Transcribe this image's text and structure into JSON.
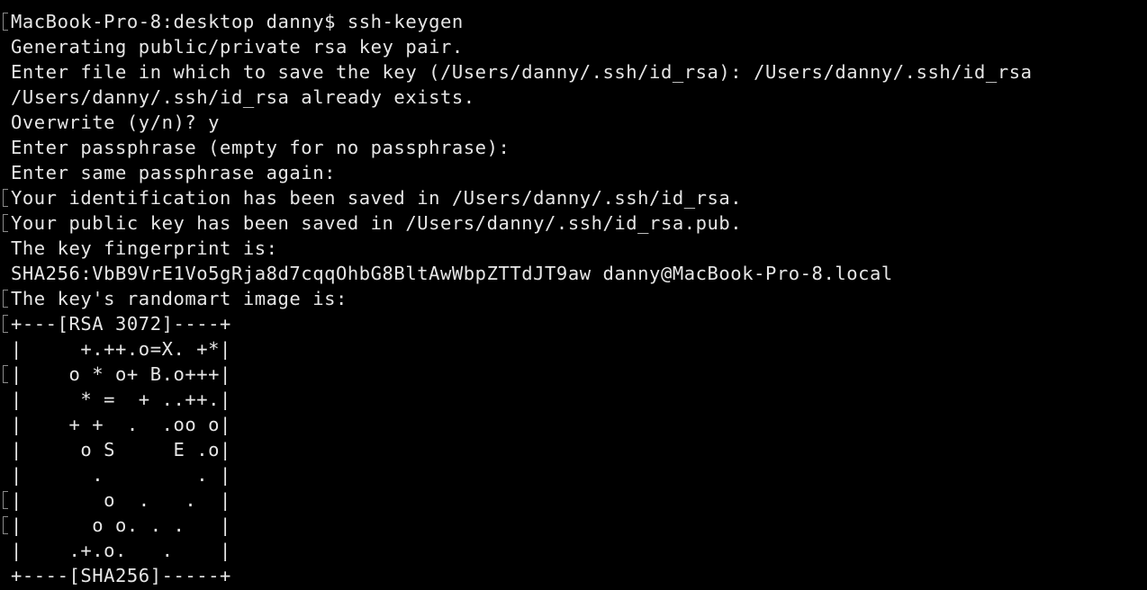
{
  "terminal": {
    "lines": [
      {
        "text": "MacBook-Pro-8:desktop danny$ ssh-keygen",
        "marked": true
      },
      {
        "text": "Generating public/private rsa key pair.",
        "marked": false
      },
      {
        "text": "Enter file in which to save the key (/Users/danny/.ssh/id_rsa): /Users/danny/.ssh/id_rsa",
        "marked": false
      },
      {
        "text": "/Users/danny/.ssh/id_rsa already exists.",
        "marked": false
      },
      {
        "text": "Overwrite (y/n)? y",
        "marked": false
      },
      {
        "text": "Enter passphrase (empty for no passphrase):",
        "marked": false
      },
      {
        "text": "Enter same passphrase again:",
        "marked": false
      },
      {
        "text": "Your identification has been saved in /Users/danny/.ssh/id_rsa.",
        "marked": true
      },
      {
        "text": "Your public key has been saved in /Users/danny/.ssh/id_rsa.pub.",
        "marked": true
      },
      {
        "text": "The key fingerprint is:",
        "marked": false
      },
      {
        "text": "SHA256:VbB9VrE1Vo5gRja8d7cqqOhbG8BltAwWbpZTTdJT9aw danny@MacBook-Pro-8.local",
        "marked": false
      },
      {
        "text": "The key's randomart image is:",
        "marked": true
      },
      {
        "text": "+---[RSA 3072]----+",
        "marked": true
      },
      {
        "text": "|     +.++.o=X. +*|",
        "marked": false
      },
      {
        "text": "|    o * o+ B.o+++|",
        "marked": true
      },
      {
        "text": "|     * =  + ..++.|",
        "marked": false
      },
      {
        "text": "|    + +  .  .oo o|",
        "marked": false
      },
      {
        "text": "|     o S     E .o|",
        "marked": false
      },
      {
        "text": "|      .        . |",
        "marked": false
      },
      {
        "text": "|       o  .   .  |",
        "marked": true
      },
      {
        "text": "|      o o. . .   |",
        "marked": true
      },
      {
        "text": "|    .+.o.   .    |",
        "marked": false
      },
      {
        "text": "+----[SHA256]-----+",
        "marked": false
      }
    ]
  }
}
